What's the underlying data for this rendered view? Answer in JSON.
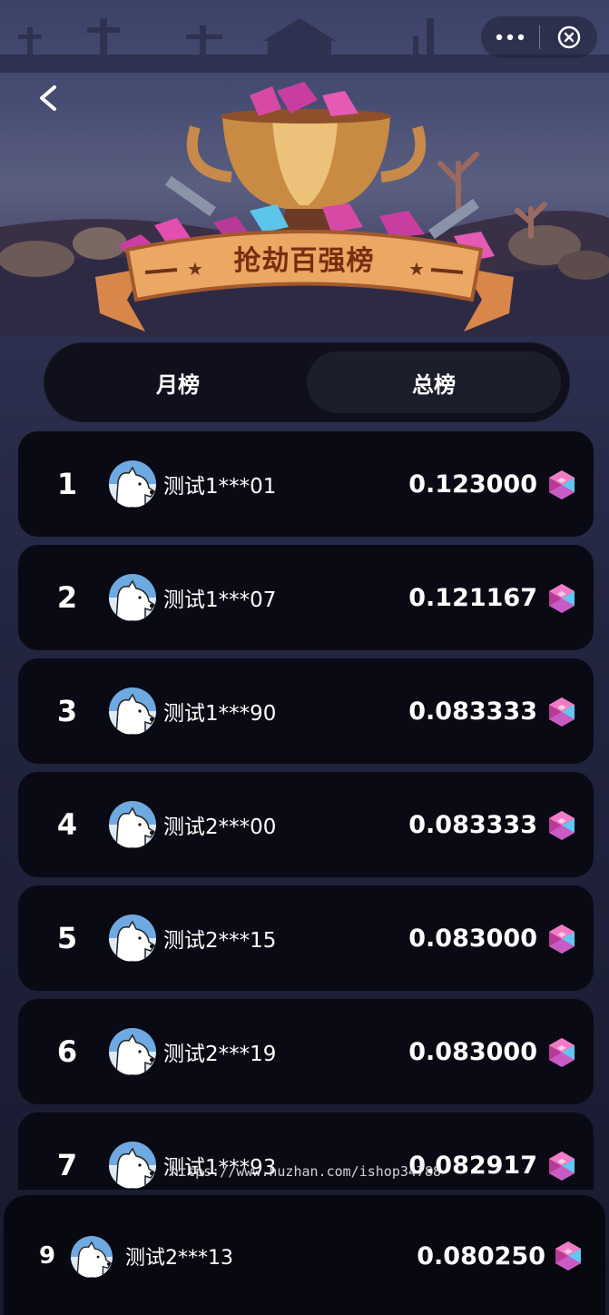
{
  "header": {
    "banner_title": "抢劫百强榜",
    "back_icon": "chevron-left-icon",
    "more_icon": "more-dots-icon",
    "close_icon": "close-circle-icon"
  },
  "tabs": [
    {
      "label": "月榜",
      "selected": false
    },
    {
      "label": "总榜",
      "selected": true
    }
  ],
  "ranking": [
    {
      "rank": "1",
      "name": "测试1***01",
      "score": "0.123000"
    },
    {
      "rank": "2",
      "name": "测试1***07",
      "score": "0.121167"
    },
    {
      "rank": "3",
      "name": "测试1***90",
      "score": "0.083333"
    },
    {
      "rank": "4",
      "name": "测试2***00",
      "score": "0.083333"
    },
    {
      "rank": "5",
      "name": "测试2***15",
      "score": "0.083000"
    },
    {
      "rank": "6",
      "name": "测试2***19",
      "score": "0.083000"
    },
    {
      "rank": "7",
      "name": "测试1***93",
      "score": "0.082917"
    }
  ],
  "self": {
    "rank": "9",
    "name": "测试2***13",
    "score": "0.080250"
  },
  "watermark": "https://www.huzhan.com/ishop34788",
  "colors": {
    "gem_pink": "#e04aa6",
    "gem_cyan": "#5fc8f0",
    "row_bg": "#090a13",
    "tab_active": "#1d1e2c"
  }
}
